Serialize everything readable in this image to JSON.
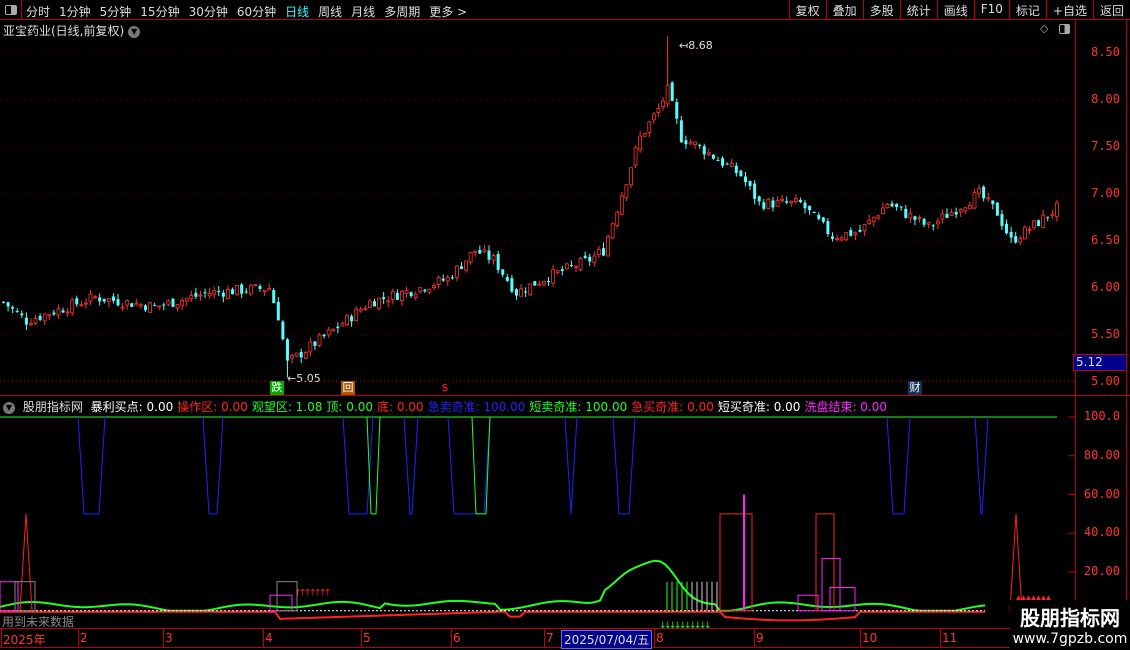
{
  "toolbar": {
    "periods": [
      "分时",
      "1分钟",
      "5分钟",
      "15分钟",
      "30分钟",
      "60分钟",
      "日线",
      "周线",
      "月线",
      "多周期",
      "更多 >"
    ],
    "active": "日线",
    "buttons": [
      "复权",
      "叠加",
      "多股",
      "统计",
      "画线",
      "F10",
      "标记",
      "+自选",
      "返回"
    ]
  },
  "main": {
    "title": "亚宝药业(日线,前复权)",
    "current_price": "5.12",
    "high_label": "8.68",
    "low_label": "5.05",
    "y_ticks": [
      "8.50",
      "8.00",
      "7.50",
      "7.00",
      "6.50",
      "6.00",
      "5.50",
      "5.00"
    ],
    "markers": [
      {
        "label": "跌",
        "color": "#0a0",
        "text": "#fff"
      },
      {
        "label": "回",
        "color": "#a50",
        "text": "#fff"
      },
      {
        "label": "$",
        "color": "#000",
        "text": "#f22"
      },
      {
        "label": "财",
        "color": "#135",
        "text": "#fff"
      }
    ]
  },
  "indicator": {
    "name": "股朋指标网",
    "legend": [
      {
        "t": "暴利买点: 0.00",
        "c": "#fff"
      },
      {
        "t": "操作区: 0.00",
        "c": "#f22"
      },
      {
        "t": "观望区: 1.08",
        "c": "#2f2"
      },
      {
        "t": "顶: 0.00",
        "c": "#2f2"
      },
      {
        "t": "底: 0.00",
        "c": "#f22"
      },
      {
        "t": "急卖奇准: 100.00",
        "c": "#22f"
      },
      {
        "t": "短卖奇准: 100.00",
        "c": "#2f2"
      },
      {
        "t": "急买奇准: 0.00",
        "c": "#f22"
      },
      {
        "t": "短买奇准: 0.00",
        "c": "#fff"
      },
      {
        "t": "洗盘结束: 0.00",
        "c": "#f2f"
      }
    ],
    "y_ticks": [
      "100.0",
      "80.00",
      "60.00",
      "40.00",
      "20.00"
    ],
    "note": "用到未来数据"
  },
  "x_axis": {
    "labels": [
      "2025年",
      "2",
      "3",
      "4",
      "5",
      "6",
      "7",
      "8",
      "9",
      "10",
      "11"
    ],
    "highlight": "2025/07/04/五"
  },
  "watermark": {
    "line1": "股朋指标网",
    "line2": "www.7gpzb.com"
  },
  "chart_data": {
    "type": "candlestick",
    "approx_close_path": [
      [
        0,
        5.85
      ],
      [
        5,
        5.65
      ],
      [
        20,
        5.9
      ],
      [
        33,
        5.8
      ],
      [
        45,
        5.95
      ],
      [
        58,
        6.0
      ],
      [
        60,
        5.7
      ],
      [
        62,
        5.2
      ],
      [
        72,
        5.55
      ],
      [
        80,
        5.85
      ],
      [
        91,
        6.0
      ],
      [
        97,
        6.1
      ],
      [
        103,
        6.4
      ],
      [
        107,
        6.3
      ],
      [
        112,
        5.95
      ],
      [
        118,
        6.1
      ],
      [
        128,
        6.3
      ],
      [
        131,
        6.4
      ],
      [
        135,
        7.0
      ],
      [
        139,
        7.6
      ],
      [
        143,
        7.9
      ],
      [
        145,
        8.1
      ],
      [
        148,
        7.6
      ],
      [
        152,
        7.5
      ],
      [
        161,
        7.2
      ],
      [
        165,
        6.9
      ],
      [
        174,
        6.9
      ],
      [
        181,
        6.55
      ],
      [
        187,
        6.6
      ],
      [
        193,
        6.9
      ],
      [
        202,
        6.65
      ],
      [
        213,
        7.0
      ],
      [
        217,
        6.8
      ],
      [
        220,
        6.5
      ],
      [
        226,
        6.7
      ],
      [
        230,
        6.85
      ]
    ],
    "high": 8.68,
    "low": 5.05,
    "ylim": [
      4.9,
      8.8
    ],
    "indicator_ylim": [
      0,
      100
    ]
  }
}
